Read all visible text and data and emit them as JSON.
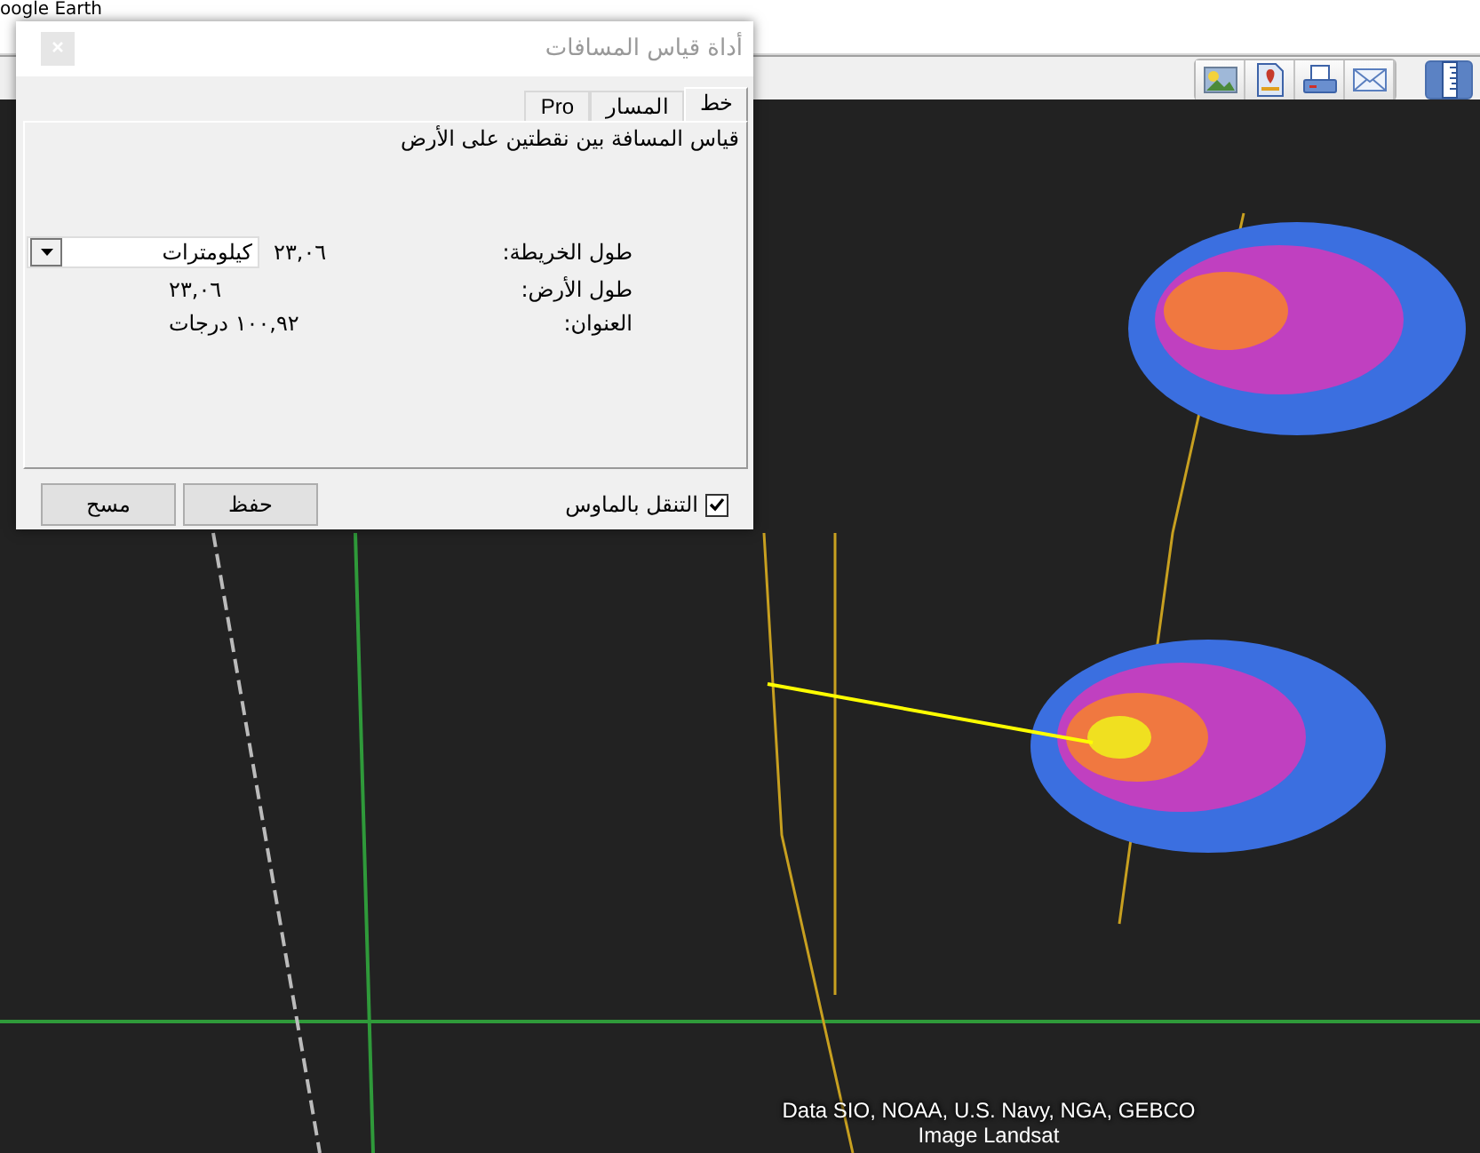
{
  "app": {
    "title": "oogle Earth"
  },
  "toolbar": [
    {
      "kind": "image",
      "selected": false
    },
    {
      "kind": "document",
      "selected": false
    },
    {
      "kind": "print",
      "selected": false
    },
    {
      "kind": "email",
      "selected": false
    },
    {
      "kind": "ruler",
      "selected": true
    }
  ],
  "dialog": {
    "title": "أداة قياس المسافات",
    "tabs": [
      {
        "label": "خط",
        "selected": true
      },
      {
        "label": "المسار",
        "selected": false
      },
      {
        "label": "Pro",
        "selected": false
      }
    ],
    "description": "قياس المسافة بين نقطتين على الأرض",
    "fields": [
      {
        "label": "طول الخريطة:",
        "value": "٢٣,٠٦",
        "unit": "كيلومترات"
      },
      {
        "label": "طول الأرض:",
        "value": "٢٣,٠٦"
      },
      {
        "label": "العنوان:",
        "value": "١٠٠,٩٢ درجات"
      }
    ],
    "mouse_nav": {
      "label": "التنقل بالماوس",
      "checked": true
    },
    "buttons": [
      "حفظ",
      "مسح"
    ]
  },
  "map": {
    "attribution": [
      "Data SIO, NOAA, U.S. Navy, NGA, GEBCO",
      "Image Landsat"
    ]
  }
}
